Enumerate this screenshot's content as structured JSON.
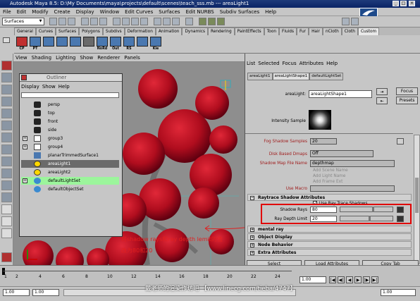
{
  "titlebar": {
    "title": "Autodesk Maya 8.5: D:\\My Documents\\maya\\projects\\default\\scenes\\teach_sss.mb   ---   areaLight1"
  },
  "menubar": [
    "File",
    "Edit",
    "Modify",
    "Create",
    "Display",
    "Window",
    "Edit Curves",
    "Surfaces",
    "Edit NURBS",
    "Subdiv Surfaces",
    "Help"
  ],
  "menuset": {
    "value": "Surfaces"
  },
  "shelf": {
    "tabs": [
      "General",
      "Curves",
      "Surfaces",
      "Polygons",
      "Subdivs",
      "Deformation",
      "Animation",
      "Dynamics",
      "Rendering",
      "PaintEffects",
      "Toon",
      "Fluids",
      "Fur",
      "Hair",
      "nCloth",
      "Cloth",
      "Custom"
    ],
    "active_tab": "Custom",
    "icon_labels": [
      "CP",
      "PT",
      "",
      "",
      "",
      "",
      "NoRd",
      "Out",
      "RS",
      "",
      "Kie"
    ]
  },
  "viewport_menu": [
    "View",
    "Shading",
    "Lighting",
    "Show",
    "Renderer",
    "Panels"
  ],
  "outliner": {
    "title": "Outliner",
    "menu": [
      "Display",
      "Show",
      "Help"
    ],
    "items": [
      {
        "label": "persp",
        "icon": "camera-icon",
        "expand": ""
      },
      {
        "label": "top",
        "icon": "camera-icon",
        "expand": ""
      },
      {
        "label": "front",
        "icon": "camera-icon",
        "expand": ""
      },
      {
        "label": "side",
        "icon": "camera-icon",
        "expand": ""
      },
      {
        "label": "group3",
        "icon": "group-icon",
        "expand": "+"
      },
      {
        "label": "group4",
        "icon": "group-icon",
        "expand": "+"
      },
      {
        "label": "planarTrimmedSurface1",
        "icon": "surface-icon",
        "expand": ""
      },
      {
        "label": "areaLight1",
        "icon": "area-light-icon",
        "expand": ""
      },
      {
        "label": "areaLight2",
        "icon": "area-light-icon",
        "expand": ""
      },
      {
        "label": "defaultLightSet",
        "icon": "light-set-icon",
        "expand": "+"
      },
      {
        "label": "defaultObjectSet",
        "icon": "object-set-icon",
        "expand": ""
      }
    ]
  },
  "attribute_editor": {
    "menu": [
      "List",
      "Selected",
      "Focus",
      "Attributes",
      "Help"
    ],
    "tabs": [
      "areaLight1",
      "areaLightShape1",
      "defaultLightSet"
    ],
    "active_tab": "areaLightShape1",
    "node_label": "areaLight:",
    "node_value": "areaLightShape1",
    "focus_label": "Focus",
    "presets_label": "Presets",
    "intensity_sample_label": "Intensity Sample",
    "fog_shadow_label": "Fog Shadow Samples",
    "fog_shadow_value": "20",
    "disk_based_label": "Disk Based Dmaps",
    "disk_based_value": "Off",
    "shadow_map_label": "Shadow Map File Name",
    "shadow_map_value": "depthmap",
    "add_scene_name": "Add Scene Name",
    "add_light_name": "Add Light Name",
    "add_frame_ext": "Add Frame Ext",
    "use_macro_label": "Use Macro",
    "raytrace_section": "Raytrace Shadow Attributes",
    "use_ray_trace": "Use Ray Trace Shadows",
    "shadow_rays_label": "Shadow Rays",
    "shadow_rays_value": "80",
    "shadow_rays_fraction": 0.62,
    "ray_depth_label": "Ray Depth Limit",
    "ray_depth_value": "20",
    "ray_depth_fraction": 0.55,
    "sections": [
      "mental ray",
      "Object Display",
      "Node Behavior",
      "Extra Attributes"
    ],
    "buttons": [
      "Select",
      "Load Attributes",
      "Copy Tab"
    ]
  },
  "annotation": {
    "line1": "将shadow rays和ray depth lemit的值",
    "line2": "改为80和20"
  },
  "watermark": "戴老师的渲染作坊吧 【www.linecg.com/tieba/4747】",
  "timeline": {
    "ticks": [
      "1",
      "2",
      "4",
      "6",
      "8",
      "10",
      "12",
      "14",
      "16",
      "18",
      "20",
      "22",
      "24"
    ],
    "current": "1.00",
    "range_start": "1.00",
    "range_field": "1.00",
    "end_value": "1.00"
  },
  "colors": {
    "title_bar": "#1e3a7a",
    "highlight_row": "#9cf59c",
    "selected_row": "#6a6a6a",
    "annotation": "#e02020",
    "box": "#e00000",
    "sphere": "#c01020"
  }
}
